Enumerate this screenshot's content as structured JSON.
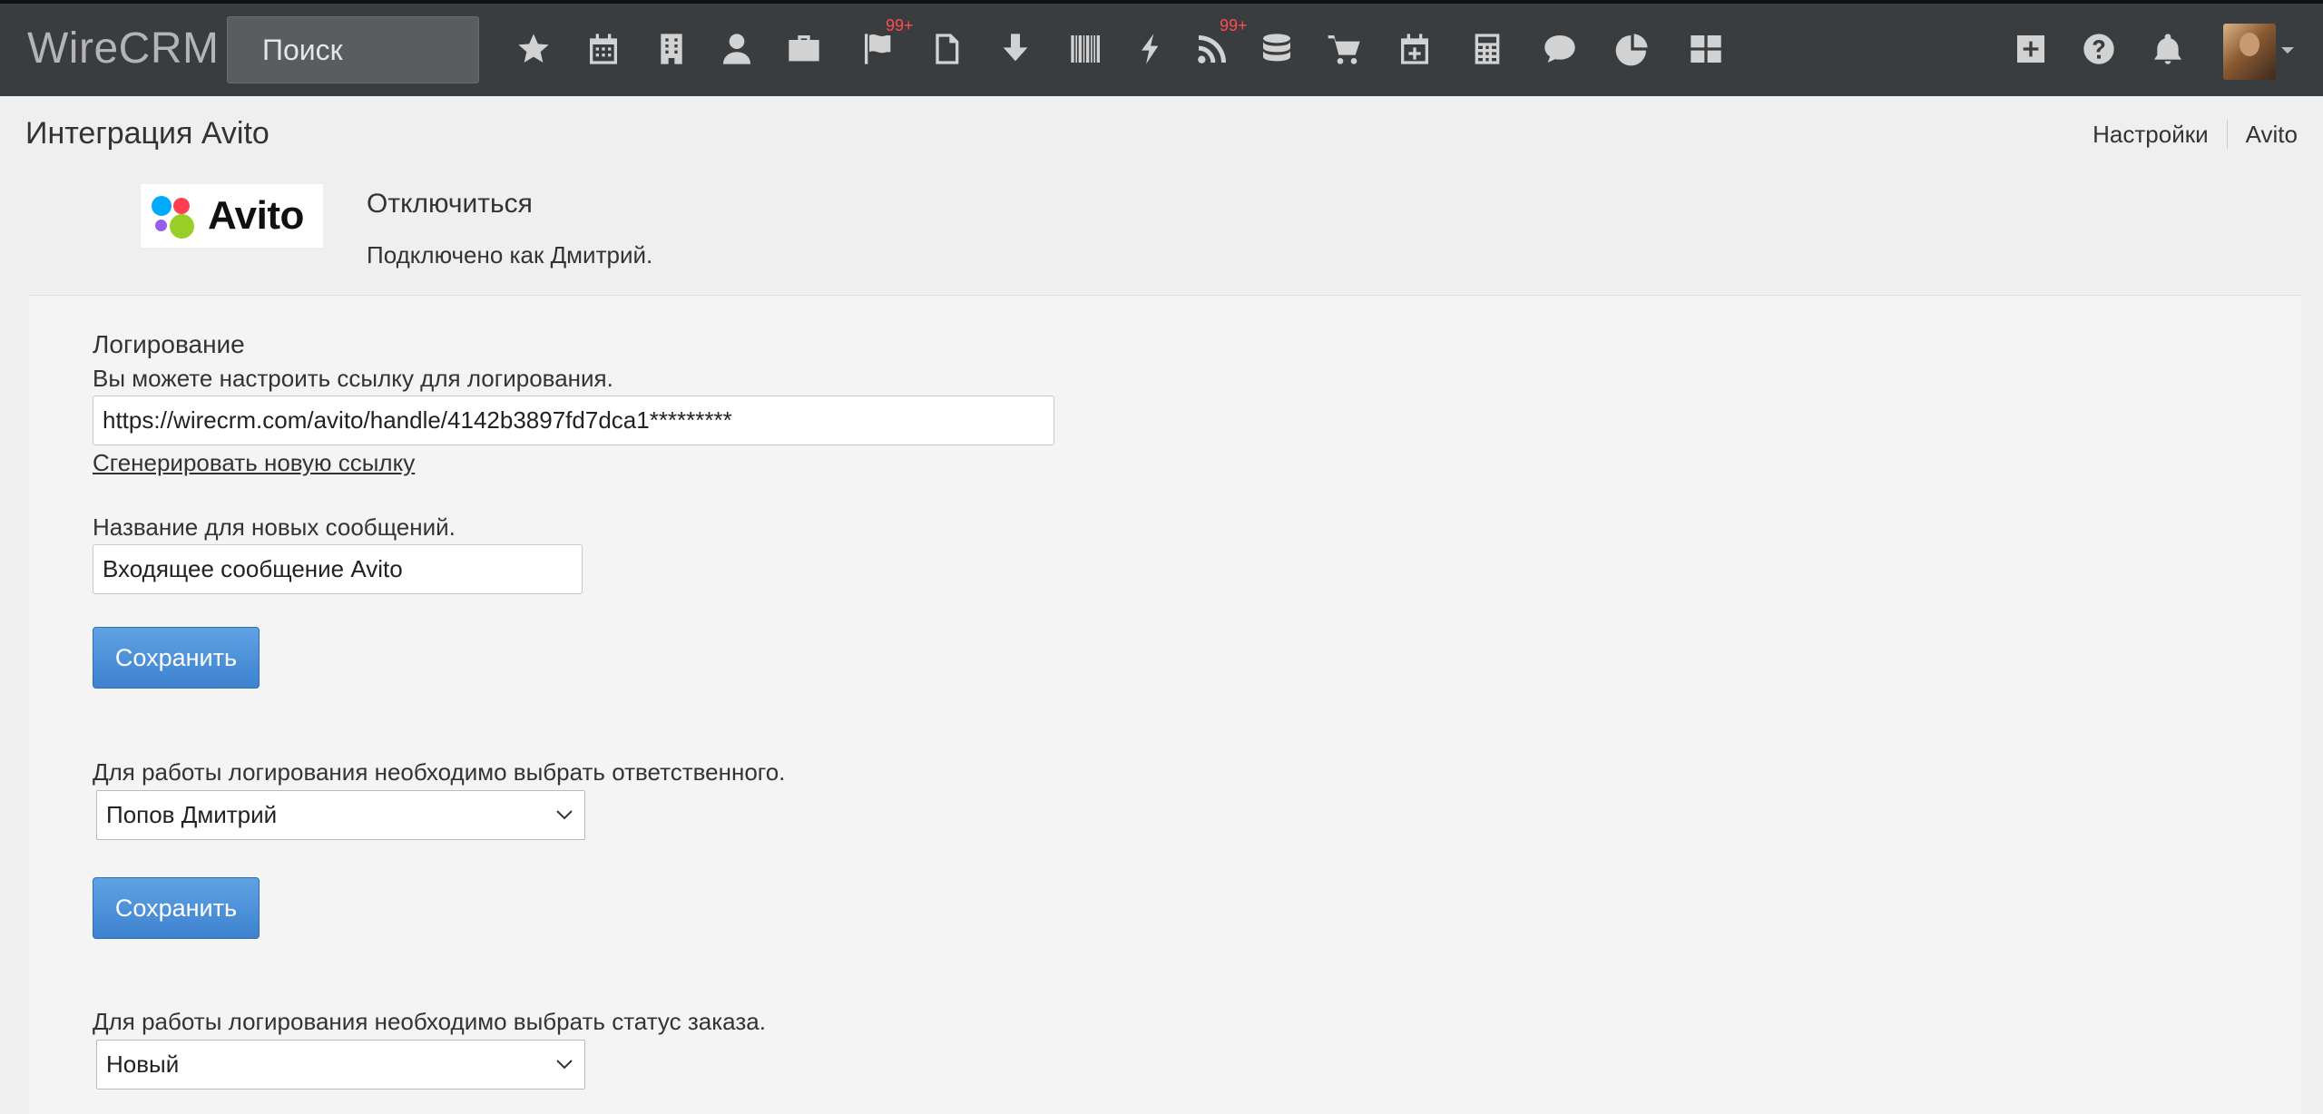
{
  "app": {
    "brand": "WireCRM"
  },
  "navbar": {
    "search_label": "Поиск",
    "icons": [
      {
        "name": "star-icon"
      },
      {
        "name": "calendar-icon"
      },
      {
        "name": "building-icon"
      },
      {
        "name": "user-icon"
      },
      {
        "name": "briefcase-icon"
      },
      {
        "name": "flag-icon",
        "badge": "99+"
      },
      {
        "name": "document-icon"
      },
      {
        "name": "download-arrow-icon"
      },
      {
        "name": "barcode-icon"
      },
      {
        "name": "lightning-icon"
      },
      {
        "name": "rss-icon",
        "badge": "99+"
      },
      {
        "name": "database-icon"
      },
      {
        "name": "cart-icon"
      },
      {
        "name": "calendar-plus-icon"
      },
      {
        "name": "calculator-icon"
      },
      {
        "name": "chat-bubble-icon"
      },
      {
        "name": "pie-chart-icon"
      },
      {
        "name": "grid-icon"
      }
    ],
    "right_icons": [
      {
        "name": "plus-square-icon"
      },
      {
        "name": "help-icon"
      },
      {
        "name": "bell-icon"
      }
    ]
  },
  "header": {
    "title": "Интеграция Avito",
    "breadcrumb": [
      "Настройки",
      "Avito"
    ]
  },
  "integration": {
    "logo_text": "Avito",
    "disconnect_label": "Отключиться",
    "connected_as": "Подключено как Дмитрий."
  },
  "logging": {
    "title": "Логирование",
    "description": "Вы можете настроить ссылку для логирования.",
    "url_value": "https://wirecrm.com/avito/handle/4142b3897fd7dca1*********",
    "generate_link": "Сгенерировать новую ссылку"
  },
  "messages": {
    "label": "Название для новых сообщений.",
    "value": "Входящее сообщение Avito",
    "save_label": "Сохранить"
  },
  "responsible": {
    "label": "Для работы логирования необходимо выбрать ответственного.",
    "selected": "Попов Дмитрий",
    "save_label": "Сохранить"
  },
  "order_status": {
    "label": "Для работы логирования необходимо выбрать статус заказа.",
    "selected": "Новый"
  },
  "colors": {
    "navbar_bg": "#3a3d3f",
    "badge": "#ff4d4d",
    "button_blue": "#4a8fd9",
    "logo_dots": [
      "#00aaff",
      "#ff4053",
      "#965eeb",
      "#97cf26"
    ]
  }
}
